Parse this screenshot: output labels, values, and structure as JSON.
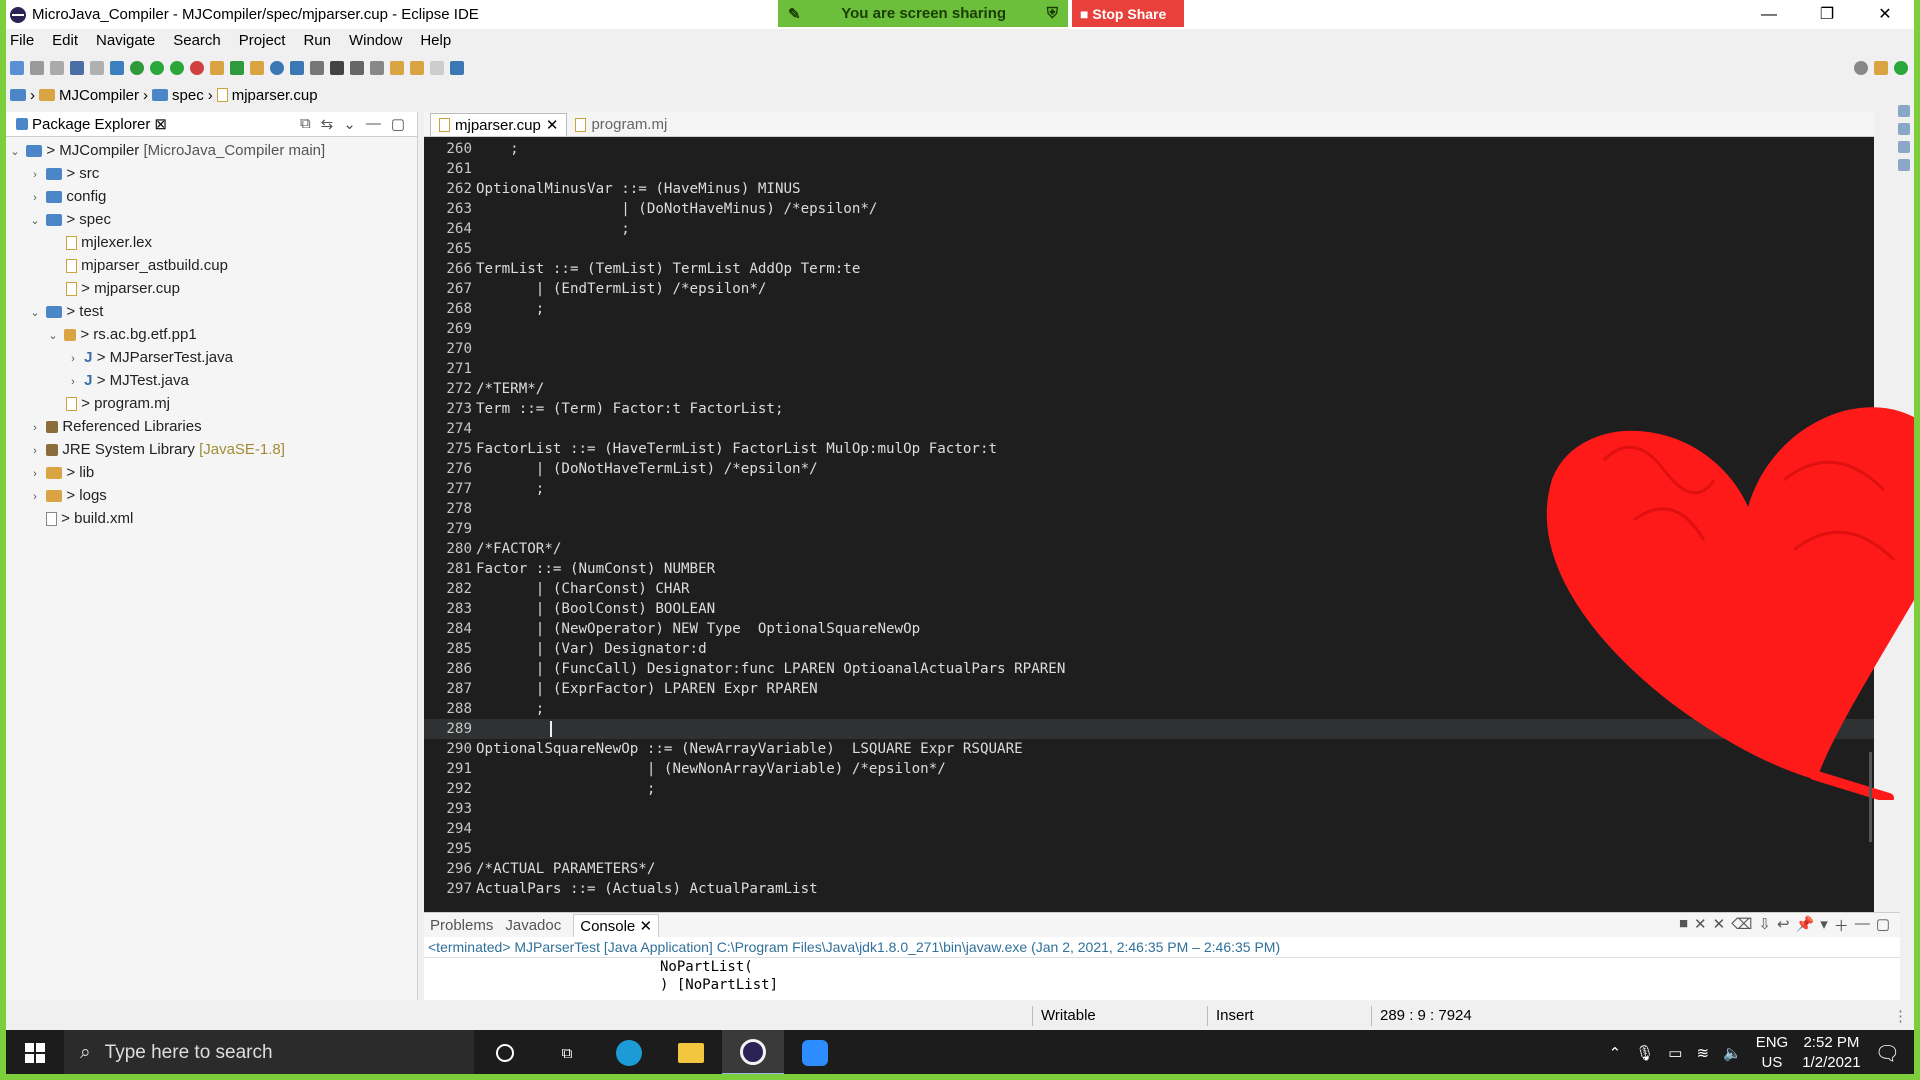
{
  "window": {
    "title": "MicroJava_Compiler - MJCompiler/spec/mjparser.cup - Eclipse IDE",
    "minimize": "—",
    "maximize": "❐",
    "close": "✕"
  },
  "share": {
    "status": "You are screen sharing",
    "stop_label": "Stop Share"
  },
  "menu": [
    "File",
    "Edit",
    "Navigate",
    "Search",
    "Project",
    "Run",
    "Window",
    "Help"
  ],
  "breadcrumb": [
    "MJCompiler",
    "spec",
    "mjparser.cup"
  ],
  "explorer": {
    "title": "Package Explorer",
    "items": [
      {
        "text": "> MJCompiler",
        "dec": "[MicroJava_Compiler main]"
      },
      {
        "text": "> src",
        "dec": ""
      },
      {
        "text": "config",
        "dec": ""
      },
      {
        "text": "> spec",
        "dec": ""
      },
      {
        "text": "mjlexer.lex",
        "dec": ""
      },
      {
        "text": "mjparser_astbuild.cup",
        "dec": ""
      },
      {
        "text": "> mjparser.cup",
        "dec": ""
      },
      {
        "text": "> test",
        "dec": ""
      },
      {
        "text": "> rs.ac.bg.etf.pp1",
        "dec": ""
      },
      {
        "text": "> MJParserTest.java",
        "dec": ""
      },
      {
        "text": "> MJTest.java",
        "dec": ""
      },
      {
        "text": "> program.mj",
        "dec": ""
      },
      {
        "text": "Referenced Libraries",
        "dec": ""
      },
      {
        "text": "JRE System Library",
        "dec": "[JavaSE-1.8]"
      },
      {
        "text": "> lib",
        "dec": ""
      },
      {
        "text": "> logs",
        "dec": ""
      },
      {
        "text": "> build.xml",
        "dec": ""
      }
    ]
  },
  "editor": {
    "tabs": [
      {
        "label": "mjparser.cup",
        "close": "✕"
      },
      {
        "label": "program.mj"
      }
    ],
    "lines": [
      {
        "n": "260",
        "t": "    ;"
      },
      {
        "n": "261",
        "t": ""
      },
      {
        "n": "262",
        "t": "OptionalMinusVar ::= (HaveMinus) MINUS"
      },
      {
        "n": "263",
        "t": "                 | (DoNotHaveMinus) /*epsilon*/"
      },
      {
        "n": "264",
        "t": "                 ;"
      },
      {
        "n": "265",
        "t": ""
      },
      {
        "n": "266",
        "t": "TermList ::= (TemList) TermList AddOp Term:te"
      },
      {
        "n": "267",
        "t": "       | (EndTermList) /*epsilon*/"
      },
      {
        "n": "268",
        "t": "       ;"
      },
      {
        "n": "269",
        "t": ""
      },
      {
        "n": "270",
        "t": ""
      },
      {
        "n": "271",
        "t": ""
      },
      {
        "n": "272",
        "t": "/*TERM*/"
      },
      {
        "n": "273",
        "t": "Term ::= (Term) Factor:t FactorList;"
      },
      {
        "n": "274",
        "t": ""
      },
      {
        "n": "275",
        "t": "FactorList ::= (HaveTermList) FactorList MulOp:mulOp Factor:t"
      },
      {
        "n": "276",
        "t": "       | (DoNotHaveTermList) /*epsilon*/"
      },
      {
        "n": "277",
        "t": "       ;"
      },
      {
        "n": "278",
        "t": ""
      },
      {
        "n": "279",
        "t": ""
      },
      {
        "n": "280",
        "t": "/*FACTOR*/"
      },
      {
        "n": "281",
        "t": "Factor ::= (NumConst) NUMBER"
      },
      {
        "n": "282",
        "t": "       | (CharConst) CHAR"
      },
      {
        "n": "283",
        "t": "       | (BoolConst) BOOLEAN"
      },
      {
        "n": "284",
        "t": "       | (NewOperator) NEW Type  OptionalSquareNewOp"
      },
      {
        "n": "285",
        "t": "       | (Var) Designator:d"
      },
      {
        "n": "286",
        "t": "       | (FuncCall) Designator:func LPAREN OptioanalActualPars RPAREN"
      },
      {
        "n": "287",
        "t": "       | (ExprFactor) LPAREN Expr RPAREN"
      },
      {
        "n": "288",
        "t": "       ;"
      },
      {
        "n": "289",
        "t": ""
      },
      {
        "n": "290",
        "t": "OptionalSquareNewOp ::= (NewArrayVariable)  LSQUARE Expr RSQUARE"
      },
      {
        "n": "291",
        "t": "                    | (NewNonArrayVariable) /*epsilon*/"
      },
      {
        "n": "292",
        "t": "                    ;"
      },
      {
        "n": "293",
        "t": ""
      },
      {
        "n": "294",
        "t": ""
      },
      {
        "n": "295",
        "t": ""
      },
      {
        "n": "296",
        "t": "/*ACTUAL PARAMETERS*/"
      },
      {
        "n": "297",
        "t": "ActualPars ::= (Actuals) ActualParamList"
      }
    ]
  },
  "console": {
    "tabs": [
      "Problems",
      "Javadoc",
      "Console"
    ],
    "close": "✕",
    "terminated": "<terminated> MJParserTest [Java Application] C:\\Program Files\\Java\\jdk1.8.0_271\\bin\\javaw.exe  (Jan 2, 2021, 2:46:35 PM – 2:46:35 PM)",
    "output": [
      "NoPartList(",
      ") [NoPartList]"
    ]
  },
  "status": {
    "writable": "Writable",
    "insert": "Insert",
    "position": "289 : 9 : 7924"
  },
  "taskbar": {
    "search_placeholder": "Type here to search",
    "lang": "ENG",
    "region": "US",
    "time": "2:52 PM",
    "date": "1/2/2021"
  },
  "colors": {
    "heart": "#ff1a1a",
    "share_green": "#6bbf3a",
    "stop_red": "#e8403a",
    "editor_bg": "#1e1e1e"
  }
}
